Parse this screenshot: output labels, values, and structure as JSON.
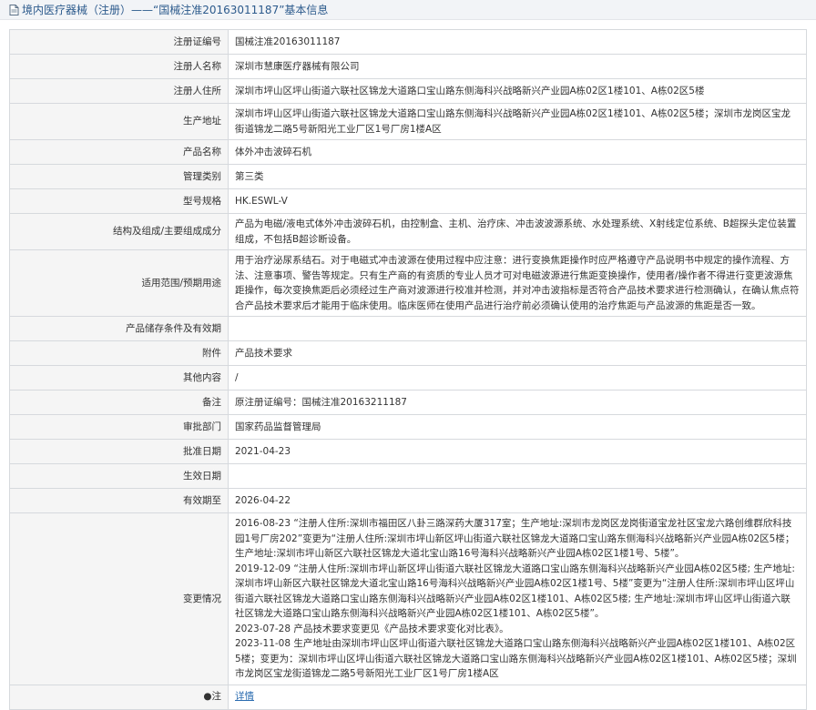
{
  "header": {
    "title": "境内医疗器械（注册）——“国械注准20163011187”基本信息"
  },
  "rows": [
    {
      "label": "注册证编号",
      "value": "国械注准20163011187"
    },
    {
      "label": "注册人名称",
      "value": "深圳市慧康医疗器械有限公司"
    },
    {
      "label": "注册人住所",
      "value": "深圳市坪山区坪山街道六联社区锦龙大道路口宝山路东侧海科兴战略新兴产业园A栋02区1楼101、A栋02区5楼"
    },
    {
      "label": "生产地址",
      "value": "深圳市坪山区坪山街道六联社区锦龙大道路口宝山路东侧海科兴战略新兴产业园A栋02区1楼101、A栋02区5楼；深圳市龙岗区宝龙街道锦龙二路5号新阳光工业厂区1号厂房1楼A区"
    },
    {
      "label": "产品名称",
      "value": "体外冲击波碎石机"
    },
    {
      "label": "管理类别",
      "value": "第三类"
    },
    {
      "label": "型号规格",
      "value": "HK.ESWL-V"
    },
    {
      "label": "结构及组成/主要组成成分",
      "value": "产品为电磁/液电式体外冲击波碎石机，由控制盒、主机、治疗床、冲击波波源系统、水处理系统、X射线定位系统、B超探头定位装置组成，不包括B超诊断设备。"
    },
    {
      "label": "适用范围/预期用途",
      "value": "用于治疗泌尿系结石。对于电磁式冲击波源在使用过程中应注意：进行变换焦距操作时应严格遵守产品说明书中规定的操作流程、方法、注意事项、警告等规定。只有生产商的有资质的专业人员才可对电磁波源进行焦距变换操作，使用者/操作者不得进行变更波源焦距操作，每次变换焦距后必须经过生产商对波源进行校准并检测，并对冲击波指标是否符合产品技术要求进行检测确认，在确认焦点符合产品技术要求后才能用于临床使用。临床医师在使用产品进行治疗前必须确认使用的治疗焦距与产品波源的焦距是否一致。"
    },
    {
      "label": "产品储存条件及有效期",
      "value": ""
    },
    {
      "label": "附件",
      "value": "产品技术要求"
    },
    {
      "label": "其他内容",
      "value": "/"
    },
    {
      "label": "备注",
      "value": "原注册证编号：国械注准20163211187"
    },
    {
      "label": "审批部门",
      "value": "国家药品监督管理局"
    },
    {
      "label": "批准日期",
      "value": "2021-04-23"
    },
    {
      "label": "生效日期",
      "value": ""
    },
    {
      "label": "有效期至",
      "value": "2026-04-22"
    }
  ],
  "changes": {
    "label": "变更情况",
    "lines": [
      "2016-08-23 “注册人住所:深圳市福田区八卦三路深药大厦317室；生产地址:深圳市龙岗区龙岗街道宝龙社区宝龙六路创维群欣科技园1号厂房202”变更为“注册人住所:深圳市坪山新区坪山街道六联社区锦龙大道路口宝山路东侧海科兴战略新兴产业园A栋02区5楼；生产地址:深圳市坪山新区六联社区锦龙大道北宝山路16号海科兴战略新兴产业园A栋02区1楼1号、5楼”。",
      "2019-12-09 “注册人住所:深圳市坪山新区坪山街道六联社区锦龙大道路口宝山路东侧海科兴战略新兴产业园A栋02区5楼; 生产地址:深圳市坪山新区六联社区锦龙大道北宝山路16号海科兴战略新兴产业园A栋02区1楼1号、5楼”变更为“注册人住所:深圳市坪山区坪山街道六联社区锦龙大道路口宝山路东侧海科兴战略新兴产业园A栋02区1楼101、A栋02区5楼; 生产地址:深圳市坪山区坪山街道六联社区锦龙大道路口宝山路东侧海科兴战略新兴产业园A栋02区1楼101、A栋02区5楼”。",
      "2023-07-28 产品技术要求变更见《产品技术要求变化对比表》。",
      "2023-11-08 生产地址由深圳市坪山区坪山街道六联社区锦龙大道路口宝山路东侧海科兴战略新兴产业园A栋02区1楼101、A栋02区5楼；变更为：深圳市坪山区坪山街道六联社区锦龙大道路口宝山路东侧海科兴战略新兴产业园A栋02区1楼101、A栋02区5楼；深圳市龙岗区宝龙街道锦龙二路5号新阳光工业厂区1号厂房1楼A区"
    ]
  },
  "note_row": {
    "label": "●注",
    "link_text": "详情"
  },
  "colors": {
    "header_text": "#2c5a8c",
    "label_bg": "#f5f5f5",
    "border": "#d6d9dd",
    "link": "#2b6cb0"
  }
}
